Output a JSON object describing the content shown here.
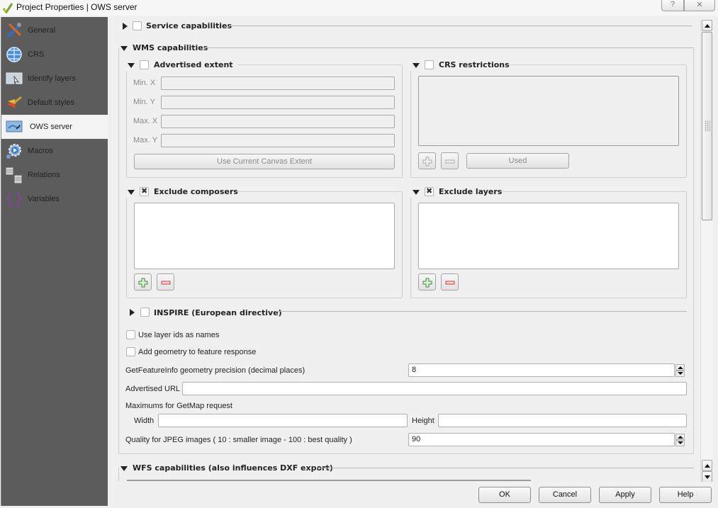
{
  "window": {
    "title": "Project Properties | OWS server",
    "help_glyph": "?",
    "close_glyph": "✕"
  },
  "sidebar": {
    "items": [
      {
        "label": "General",
        "icon": "wrench-screwdriver-icon",
        "active": false
      },
      {
        "label": "CRS",
        "icon": "globe-icon",
        "active": false
      },
      {
        "label": "Identify layers",
        "icon": "identify-map-icon",
        "active": false
      },
      {
        "label": "Default styles",
        "icon": "paint-styles-icon",
        "active": false
      },
      {
        "label": "OWS server",
        "icon": "ows-map-icon",
        "active": true
      },
      {
        "label": "Macros",
        "icon": "macro-gear-icon",
        "active": false
      },
      {
        "label": "Relations",
        "icon": "relations-table-icon",
        "active": false
      },
      {
        "label": "Variables",
        "icon": "variables-icon",
        "active": false
      }
    ]
  },
  "service_capabilities": {
    "title": "Service capabilities",
    "checked": false,
    "collapsed": true
  },
  "wms": {
    "title": "WMS capabilities",
    "advertised_extent": {
      "title": "Advertised extent",
      "checked": false,
      "fields": [
        {
          "label": "Min. X",
          "value": ""
        },
        {
          "label": "Min. Y",
          "value": ""
        },
        {
          "label": "Max. X",
          "value": ""
        },
        {
          "label": "Max. Y",
          "value": ""
        }
      ],
      "button": "Use Current Canvas Extent"
    },
    "crs_restrictions": {
      "title": "CRS restrictions",
      "checked": false,
      "used_button": "Used"
    },
    "exclude_composers": {
      "title": "Exclude composers",
      "checked": true
    },
    "exclude_layers": {
      "title": "Exclude layers",
      "checked": true
    },
    "inspire": {
      "title": "INSPIRE (European directive)",
      "checked": false,
      "collapsed": true
    },
    "use_layer_ids": {
      "label": "Use layer ids as names",
      "checked": false
    },
    "add_geometry": {
      "label": "Add geometry to feature response",
      "checked": false
    },
    "precision": {
      "label": "GetFeatureInfo geometry precision (decimal places)",
      "value": "8"
    },
    "advertised_url": {
      "label": "Advertised URL",
      "value": ""
    },
    "maximums": {
      "label": "Maximums for GetMap request",
      "width_label": "Width",
      "width_value": "",
      "height_label": "Height",
      "height_value": ""
    },
    "jpeg_quality": {
      "label": "Quality for JPEG images ( 10 : smaller image - 100 : best quality )",
      "value": "90"
    }
  },
  "wfs": {
    "title": "WFS capabilities (also influences DXF export)"
  },
  "footer": {
    "ok": "OK",
    "cancel": "Cancel",
    "apply": "Apply",
    "help": "Help"
  }
}
